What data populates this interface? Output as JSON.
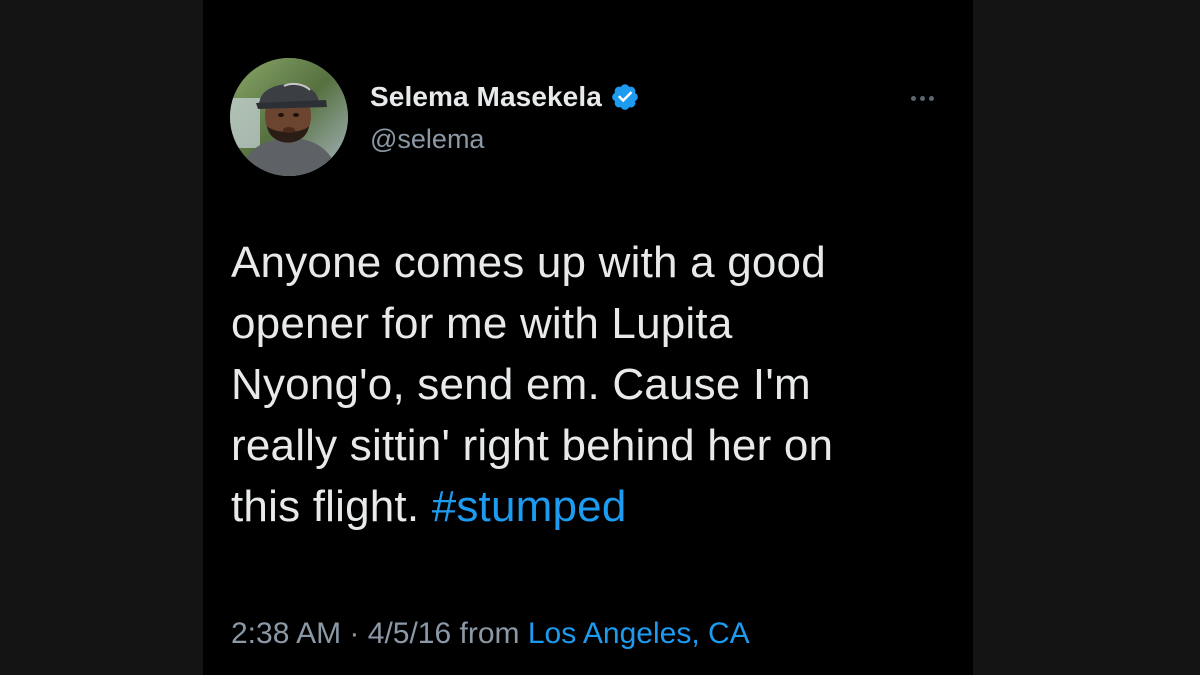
{
  "author": {
    "name": "Selema Masekela",
    "handle": "@selema",
    "verified": true,
    "avatar_icon": "user-photo-avatar"
  },
  "more_icon": "more-horizontal-icon",
  "tweet": {
    "text_lines": [
      "Anyone comes up with a good",
      "opener for me with Lupita",
      "Nyong'o, send em. Cause I'm",
      "really sittin' right behind her on",
      "this flight. "
    ],
    "hashtag": "#stumped"
  },
  "meta": {
    "time": "2:38 AM",
    "separator": "·",
    "date": "4/5/16",
    "from_label": "from",
    "location": "Los Angeles, CA"
  },
  "colors": {
    "background": "#000000",
    "text": "#e7e9ea",
    "secondary": "#8b98a5",
    "accent": "#1d9bf0"
  }
}
